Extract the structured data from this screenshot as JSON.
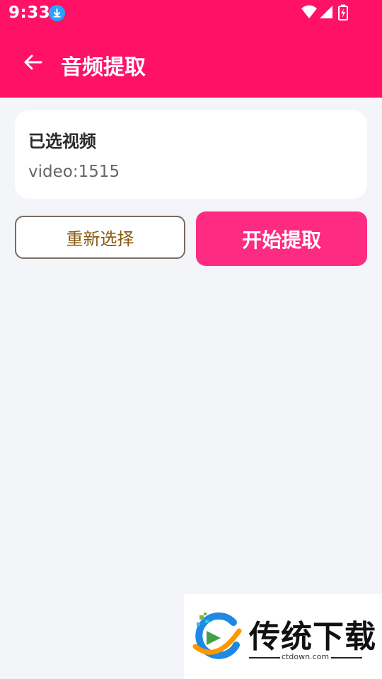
{
  "status_bar": {
    "time": "9:33",
    "icons": [
      "download-icon",
      "wifi-icon",
      "signal-icon",
      "battery-charging-icon"
    ]
  },
  "header": {
    "title": "音频提取",
    "back_icon": "arrow-left-icon"
  },
  "selected_video": {
    "title": "已选视频",
    "value": "video:1515"
  },
  "actions": {
    "reselect_label": "重新选择",
    "start_label": "开始提取"
  },
  "watermark": {
    "brand": "传统下载",
    "url": "ctdown.com"
  },
  "colors": {
    "appbar": "#ff1166",
    "primary_button": "#ff2a82",
    "background": "#f4f5f9",
    "outline_button_border": "#7a6a60",
    "outline_button_text": "#8a5a10"
  }
}
